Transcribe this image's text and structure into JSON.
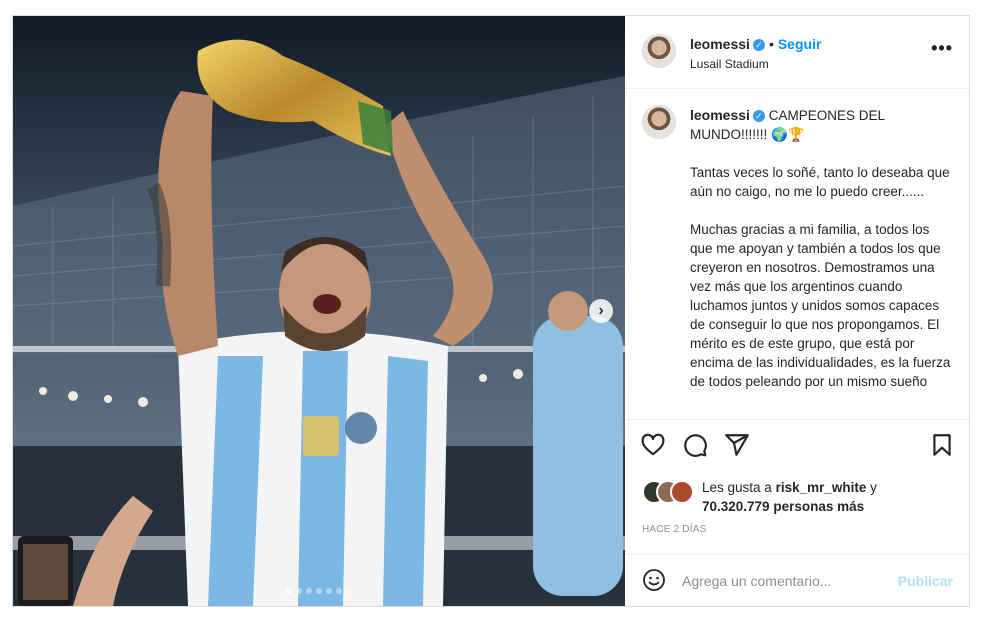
{
  "post": {
    "username": "leomessi",
    "follow_label": "Seguir",
    "location": "Lusail Stadium",
    "separator": "•",
    "more_label": "•••"
  },
  "caption": {
    "username": "leomessi",
    "headline": "CAMPEONES DEL MUNDO!!!!!!! 🌍🏆",
    "paragraphs": [
      "Tantas veces lo soñé, tanto lo deseaba que aún no caigo, no me lo puedo creer......",
      "Muchas gracias a mi familia, a todos los que me apoyan y también a todos los que creyeron en nosotros. Demostramos una vez más que los argentinos cuando luchamos juntos y unidos somos capaces de conseguir lo que nos propongamos. El mérito es de este grupo, que está por encima de las individualidades, es la fuerza de todos peleando por un mismo sueño"
    ]
  },
  "likes": {
    "prefix": "Les gusta a",
    "user": "risk_mr_white",
    "connector": "y",
    "count": "70.320.779 personas más"
  },
  "time_ago": "HACE 2 DÍAS",
  "comment": {
    "placeholder": "Agrega un comentario...",
    "publish_label": "Publicar"
  },
  "carousel": {
    "total": 7,
    "active_index": 0
  },
  "icons": {
    "like": "heart-icon",
    "comment": "comment-icon",
    "share": "share-icon",
    "save": "bookmark-icon",
    "emoji": "emoji-icon",
    "next": "chevron-right-icon"
  },
  "colors": {
    "link": "#0095f6",
    "verified": "#3897f0",
    "publish_disabled": "#b2dffc",
    "text": "#262626",
    "muted": "#8e8e8e"
  }
}
